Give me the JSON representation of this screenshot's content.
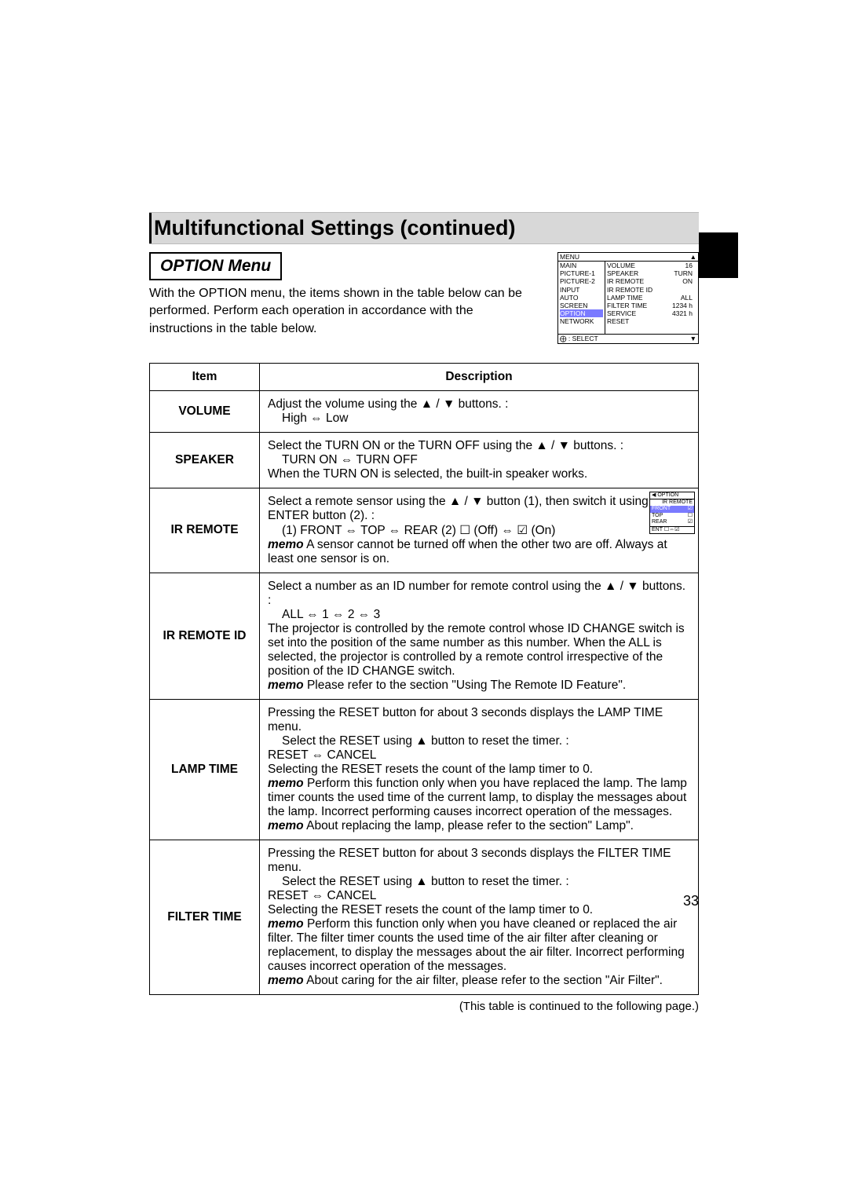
{
  "section_title": "Multifunctional Settings (continued)",
  "submenu_title": "OPTION Menu",
  "intro": "With the  OPTION menu, the items shown in the table below can be performed. Perform each operation in accordance with the instructions in the table below.",
  "osd": {
    "head_left": "MENU",
    "head_right": "▲",
    "left": [
      "MAIN",
      "PICTURE-1",
      "PICTURE-2",
      "INPUT",
      "AUTO",
      "SCREEN",
      "OPTION",
      "NETWORK"
    ],
    "mid": [
      "VOLUME",
      "SPEAKER",
      "IR REMOTE",
      "IR REMOTE ID",
      "LAMP TIME",
      "FILTER TIME",
      "SERVICE",
      "RESET"
    ],
    "right": [
      "16",
      "TURN ON",
      "",
      "ALL",
      "1234 h",
      "4321 h",
      "",
      ""
    ],
    "foot_left": "⨁ : SELECT",
    "foot_right": "▼",
    "highlight_index": 6
  },
  "table": {
    "header_item": "Item",
    "header_desc": "Description",
    "rows": [
      {
        "item": "VOLUME",
        "desc": {
          "line1": "Adjust the volume using the ▲ / ▼ buttons. :",
          "line2": "High ⇔ Low"
        }
      },
      {
        "item": "SPEAKER",
        "desc": {
          "line1": "Select the TURN ON or the TURN OFF using the ▲ / ▼ buttons. :",
          "line2": "TURN ON ⇔ TURN OFF",
          "line3": "When the TURN ON is selected, the built-in speaker works."
        }
      },
      {
        "item": "IR REMOTE",
        "desc": {
          "line1": "Select a remote sensor using the ▲ / ▼ button (1), then switch it using the ENTER button (2). :",
          "line2": "(1) FRONT ⇔ TOP ⇔ REAR   (2) ☐ (Off)  ⇔ ☑ (On)",
          "memo1": "memo",
          "memo1_text": " A sensor cannot be turned off when the other two are off. Always at least one sensor is on."
        },
        "small_osd": {
          "title_left": "◀  OPTION",
          "r1": "IR REMOTE",
          "rows": [
            {
              "l": "FRONT",
              "r": "☑",
              "hl": true
            },
            {
              "l": "TOP",
              "r": "☐"
            },
            {
              "l": "REAR",
              "r": "☑"
            }
          ],
          "foot": "ENT ☐⇔☑"
        }
      },
      {
        "item": "IR REMOTE ID",
        "desc": {
          "line1": "Select a number as an ID number for remote control using the ▲ / ▼ buttons. :",
          "line2": "ALL ⇔ 1 ⇔ 2 ⇔ 3",
          "line3": "The projector is controlled by the remote control whose ID CHANGE switch is set into the position of the same number as this number. When the ALL is selected, the projector is controlled by a remote control irrespective of the position of the ID CHANGE switch.",
          "memo1": "memo",
          "memo1_text": " Please refer to the section \"Using The Remote ID Feature\"."
        }
      },
      {
        "item": "LAMP TIME",
        "desc": {
          "line1": "Pressing the RESET button for about 3 seconds displays the LAMP TIME menu.",
          "line2": "Select the RESET using ▲ button to reset the timer. :",
          "line3": "RESET ⇔ CANCEL",
          "line4": "Selecting the RESET resets the count of the lamp timer to 0.",
          "memo1": "memo",
          "memo1_text": " Perform this function only when you have replaced the lamp. The lamp timer counts the used time of the current lamp, to display the messages about the lamp. Incorrect performing causes incorrect operation of the messages.",
          "memo2": "memo",
          "memo2_text": " About replacing the lamp, please refer to the section\" Lamp\"."
        }
      },
      {
        "item": "FILTER TIME",
        "desc": {
          "line1": "Pressing the RESET button for about 3 seconds displays the FILTER TIME menu.",
          "line2": "Select the RESET using ▲ button to reset the timer. :",
          "line3": "RESET ⇔ CANCEL",
          "line4": "Selecting the RESET resets the count of the lamp timer to 0.",
          "memo1": "memo",
          "memo1_text": " Perform this function only when you have cleaned or replaced the air filter. The filter timer counts the used time of the air filter after cleaning or replacement, to display the messages about the air filter. Incorrect performing causes incorrect operation of the messages.",
          "memo2": "memo",
          "memo2_text": " About caring for the air filter, please refer to the section \"Air Filter\"."
        }
      }
    ]
  },
  "table_note": "(This table is continued to the following page.)",
  "page_number": "33"
}
